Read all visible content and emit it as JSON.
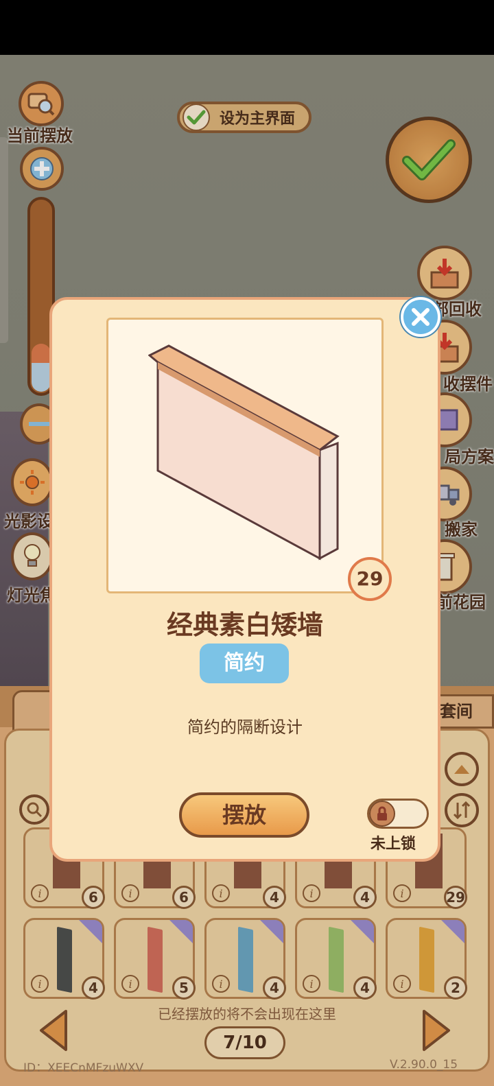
{
  "top": {
    "current_placement_label": "当前摆放",
    "set_main_screen_label": "设为主界面"
  },
  "left_side": {
    "light_shadow_label": "光影设",
    "lamp_label": "灯光焦"
  },
  "right_side": {
    "recycle_label": "部回收",
    "collect_label": "收摆件",
    "plan_label": "局方案",
    "move_label": "搬家",
    "garden_label": "前花园"
  },
  "bottom": {
    "tab_suite_label": "套间",
    "hint": "已经摆放的将不会出现在这里",
    "page_indicator": "7/10",
    "id_label": "ID：XEECnMFzuWXV",
    "version": "V.2.90.0_15",
    "row1_counts": [
      "6",
      "6",
      "4",
      "4",
      "29"
    ],
    "row2_counts": [
      "4",
      "5",
      "4",
      "4",
      "2"
    ],
    "row2_curtain_colors": [
      "#4b4e4c",
      "#d46e5a",
      "#6aa8c4",
      "#9cc26a",
      "#e6a83c"
    ]
  },
  "modal": {
    "item_count": "29",
    "item_name": "经典素白矮墙",
    "style_tag": "简约",
    "description": "简约的隔断设计",
    "place_button": "摆放",
    "lock_status": "未上锁"
  },
  "colors": {
    "accent_blue": "#7cc3e6",
    "button_orange": "#f0b060",
    "modal_bg": "#fbe6bf"
  }
}
